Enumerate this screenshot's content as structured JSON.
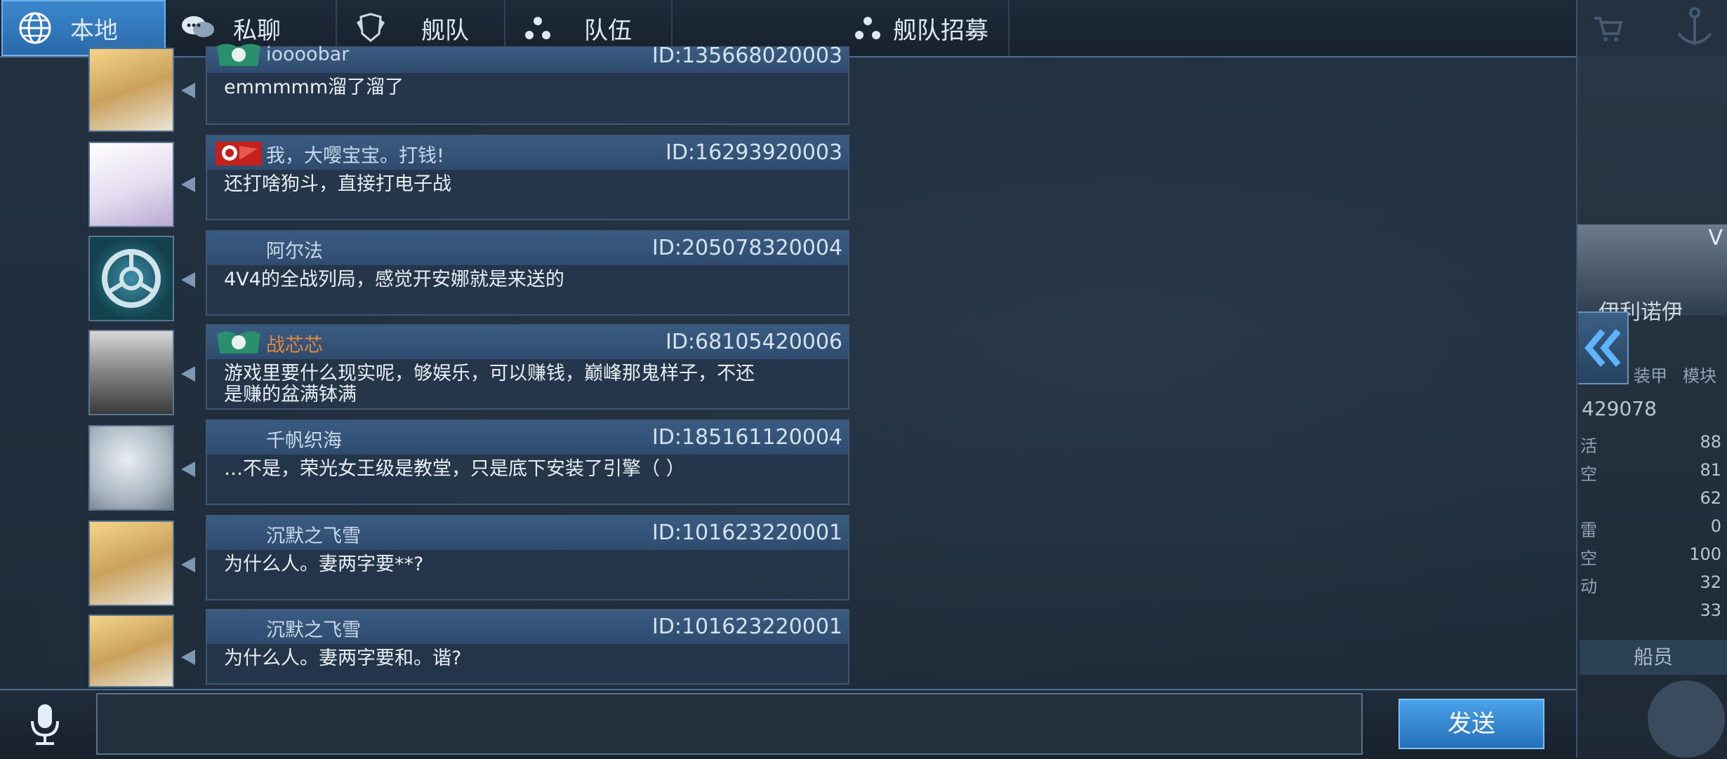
{
  "tabs": [
    {
      "label": "本地",
      "icon": "globe-icon",
      "active": true
    },
    {
      "label": "私聊",
      "icon": "chat-bubbles-icon",
      "active": false
    },
    {
      "label": "舰队",
      "icon": "fleet-emblem-icon",
      "active": false
    },
    {
      "label": "队伍",
      "icon": "team-dots-icon",
      "active": false
    },
    {
      "label": "舰队招募",
      "icon": "recruit-dots-icon",
      "active": false
    }
  ],
  "messages": [
    {
      "name": "ioooobar",
      "id": "ID:135668020003",
      "text": "emmmmm溜了溜了"
    },
    {
      "name": "我，大嘤宝宝。打钱!",
      "id": "ID:16293920003",
      "text": "还打啥狗斗，直接打电子战"
    },
    {
      "name": "阿尔法",
      "id": "ID:205078320004",
      "text": "4V4的全战列局，感觉开安娜就是来送的"
    },
    {
      "name": "战芯芯",
      "id": "ID:68105420006",
      "text": "游戏里要什么现实呢，够娱乐，可以赚钱，巅峰那鬼样子，不还",
      "text2": "是赚的盆满钵满"
    },
    {
      "name": "千帆织海",
      "id": "ID:185161120004",
      "text": "…不是，荣光女王级是教堂，只是底下安装了引擎（ ）"
    },
    {
      "name": "沉默之飞雪",
      "id": "ID:101623220001",
      "text": "为什么人。妻两字要**?"
    },
    {
      "name": "沉默之飞雪",
      "id": "ID:101623220001",
      "text": "为什么人。妻两字要和。谐?"
    }
  ],
  "input": {
    "value": ""
  },
  "send_label": "发送",
  "side": {
    "label_v": "V",
    "ship_name": "伊利诺伊",
    "tab_a": "装甲",
    "tab_b": "模块",
    "number": "429078",
    "stats": [
      {
        "k": "活",
        "v": "88"
      },
      {
        "k": "空",
        "v": "81"
      },
      {
        "k": "",
        "v": "62"
      },
      {
        "k": "雷",
        "v": "0"
      },
      {
        "k": "空",
        "v": "100"
      },
      {
        "k": "动",
        "v": "32"
      },
      {
        "k": "",
        "v": "33"
      }
    ],
    "crew_label": "船员"
  },
  "colors": {
    "accent": "#3b87cf",
    "name_orange": "#e2893a",
    "header_blue": "#3a5b82"
  }
}
